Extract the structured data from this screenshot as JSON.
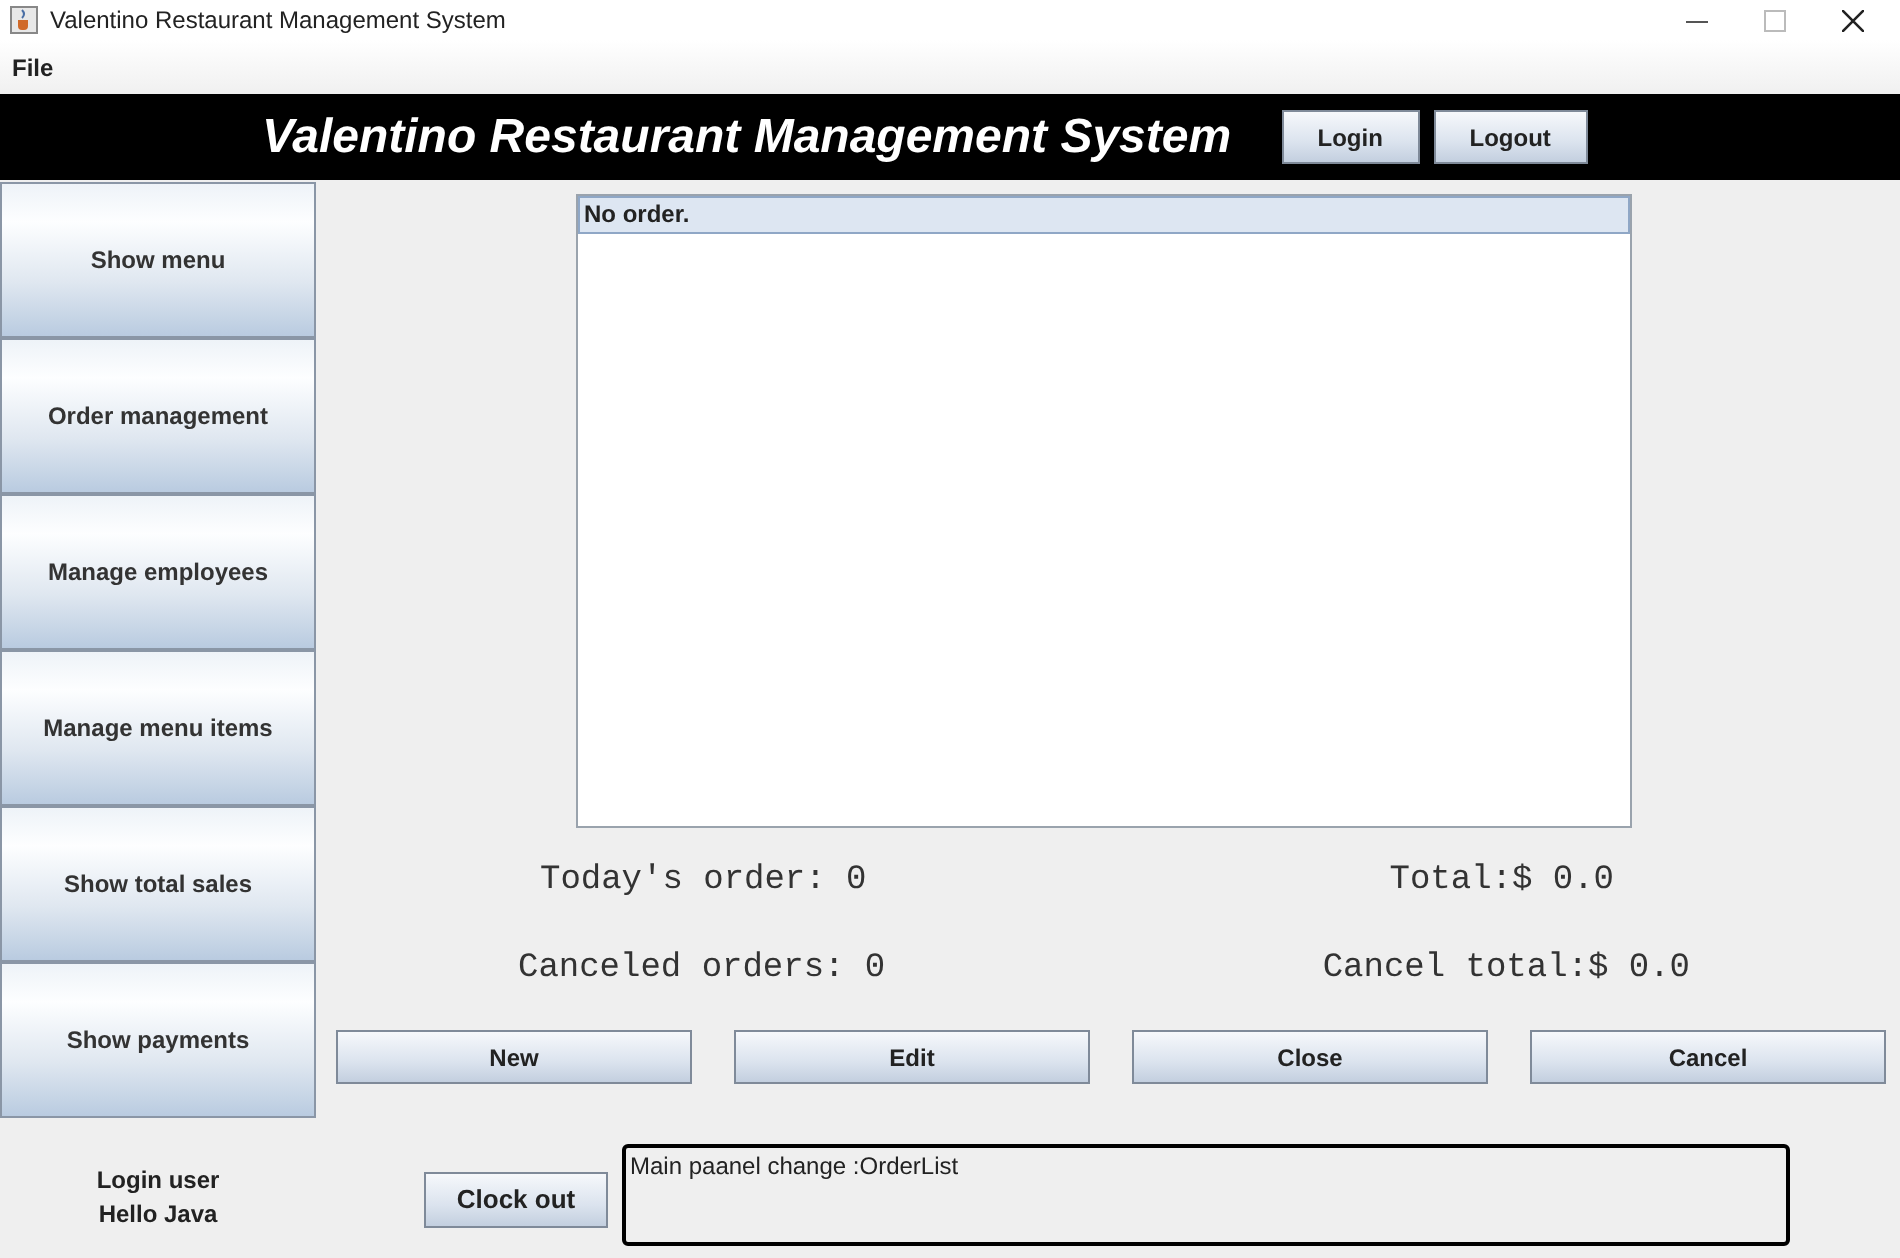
{
  "window": {
    "title": "Valentino Restaurant Management System"
  },
  "menu": [
    "File"
  ],
  "header": {
    "title": "Valentino Restaurant Management System",
    "buttons": [
      "Login",
      "Logout"
    ]
  },
  "sidebar": {
    "items": [
      "Show menu",
      "Order management",
      "Manage employees",
      "Manage menu items",
      "Show total sales",
      "Show payments"
    ]
  },
  "order_list": {
    "items": [
      {
        "text": "No order.",
        "selected": true
      }
    ]
  },
  "stats": [
    {
      "left": "Today's order: 0",
      "right": "Total:$ 0.0"
    },
    {
      "left": "Canceled orders: 0",
      "right": "Cancel total:$ 0.0"
    }
  ],
  "actions": [
    "New",
    "Edit",
    "Close",
    "Cancel"
  ],
  "login_user": {
    "label": "Login user",
    "name": "Hello Java"
  },
  "clock_out": "Clock out",
  "status_message": "Main paanel change :OrderList"
}
